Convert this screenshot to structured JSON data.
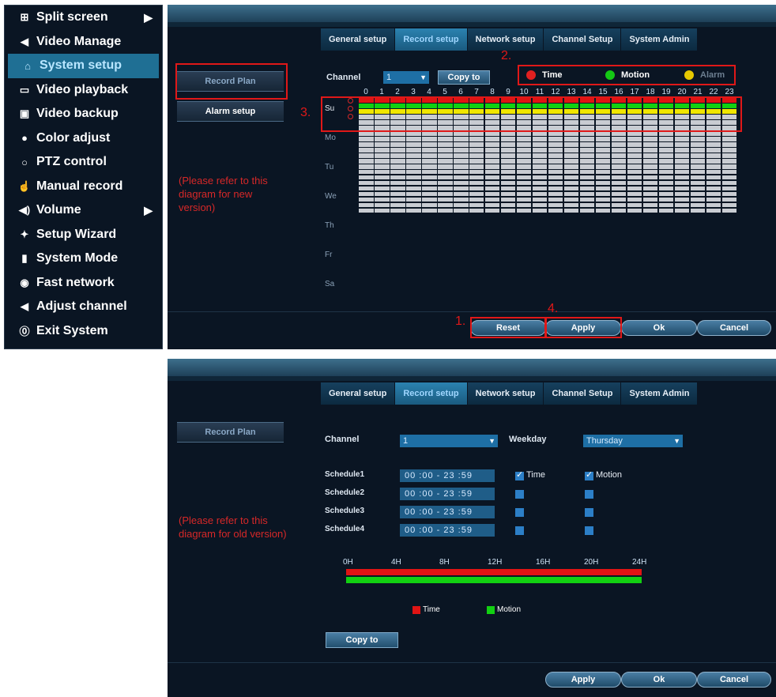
{
  "menu": {
    "items": [
      {
        "icon": "⊞",
        "icon_name": "split-screen-icon",
        "label": "Split screen",
        "arrow": "▶"
      },
      {
        "icon": "◀",
        "icon_name": "video-manage-icon",
        "label": "Video Manage"
      },
      {
        "icon": "⌂",
        "icon_name": "home-icon",
        "label": "System setup",
        "active": true
      },
      {
        "icon": "▭",
        "icon_name": "film-icon",
        "label": "Video playback"
      },
      {
        "icon": "▣",
        "icon_name": "save-icon",
        "label": "Video backup"
      },
      {
        "icon": "●",
        "icon_name": "palette-icon",
        "label": "Color adjust"
      },
      {
        "icon": "○",
        "icon_name": "ptz-icon",
        "label": "PTZ control"
      },
      {
        "icon": "☝",
        "icon_name": "hand-icon",
        "label": "Manual record"
      },
      {
        "icon": "◀)",
        "icon_name": "speaker-icon",
        "label": "Volume",
        "arrow": "▶"
      },
      {
        "icon": "✦",
        "icon_name": "wizard-icon",
        "label": "Setup Wizard"
      },
      {
        "icon": "▮",
        "icon_name": "document-icon",
        "label": "System Mode"
      },
      {
        "icon": "◉",
        "icon_name": "network-icon",
        "label": "Fast network"
      },
      {
        "icon": "◀",
        "icon_name": "adjust-channel-icon",
        "label": "Adjust channel"
      },
      {
        "icon": "⓪",
        "icon_name": "power-icon",
        "label": "Exit System"
      }
    ]
  },
  "tabs": [
    "General setup",
    "Record setup",
    "Network setup",
    "Channel Setup",
    "System Admin"
  ],
  "top": {
    "side_buttons": [
      "Record Plan",
      "Alarm setup"
    ],
    "note": "(Please refer to this diagram for new version)",
    "channel_label": "Channel",
    "channel_value": "1",
    "copy_to": "Copy to",
    "legend": [
      {
        "label": "Time",
        "color": "#e02020"
      },
      {
        "label": "Motion",
        "color": "#14c814"
      },
      {
        "label": "Alarm",
        "color": "#e6c800"
      }
    ],
    "hours": [
      "0",
      "1",
      "2",
      "3",
      "4",
      "5",
      "6",
      "7",
      "8",
      "9",
      "10",
      "11",
      "12",
      "13",
      "14",
      "15",
      "16",
      "17",
      "18",
      "19",
      "20",
      "21",
      "22",
      "23"
    ],
    "days": [
      "Su",
      "Mo",
      "Tu",
      "We",
      "Th",
      "Fr",
      "Sa"
    ],
    "annotations": [
      "1.",
      "2.",
      "3.",
      "4."
    ],
    "footer_buttons": [
      "Reset",
      "Apply",
      "Ok",
      "Cancel"
    ]
  },
  "bottom": {
    "side_buttons": [
      "Record Plan"
    ],
    "note": "(Please refer to this diagram for old version)",
    "channel_label": "Channel",
    "channel_value": "1",
    "weekday_label": "Weekday",
    "weekday_value": "Thursday",
    "schedules": [
      {
        "label": "Schedule1",
        "time": "00 :00  -  23 :59",
        "time_checked": true,
        "motion_checked": true
      },
      {
        "label": "Schedule2",
        "time": "00 :00  -  23 :59",
        "time_checked": false,
        "motion_checked": false
      },
      {
        "label": "Schedule3",
        "time": "00 :00  -  23 :59",
        "time_checked": false,
        "motion_checked": false
      },
      {
        "label": "Schedule4",
        "time": "00 :00  -  23 :59",
        "time_checked": false,
        "motion_checked": false
      }
    ],
    "time_label": "Time",
    "motion_label": "Motion",
    "timeline_labels": [
      "0H",
      "4H",
      "8H",
      "12H",
      "16H",
      "20H",
      "24H"
    ],
    "legend": [
      {
        "label": "Time",
        "color": "#e01414"
      },
      {
        "label": "Motion",
        "color": "#12d012"
      }
    ],
    "copy_to": "Copy to",
    "footer_buttons": [
      "Apply",
      "Ok",
      "Cancel"
    ]
  }
}
